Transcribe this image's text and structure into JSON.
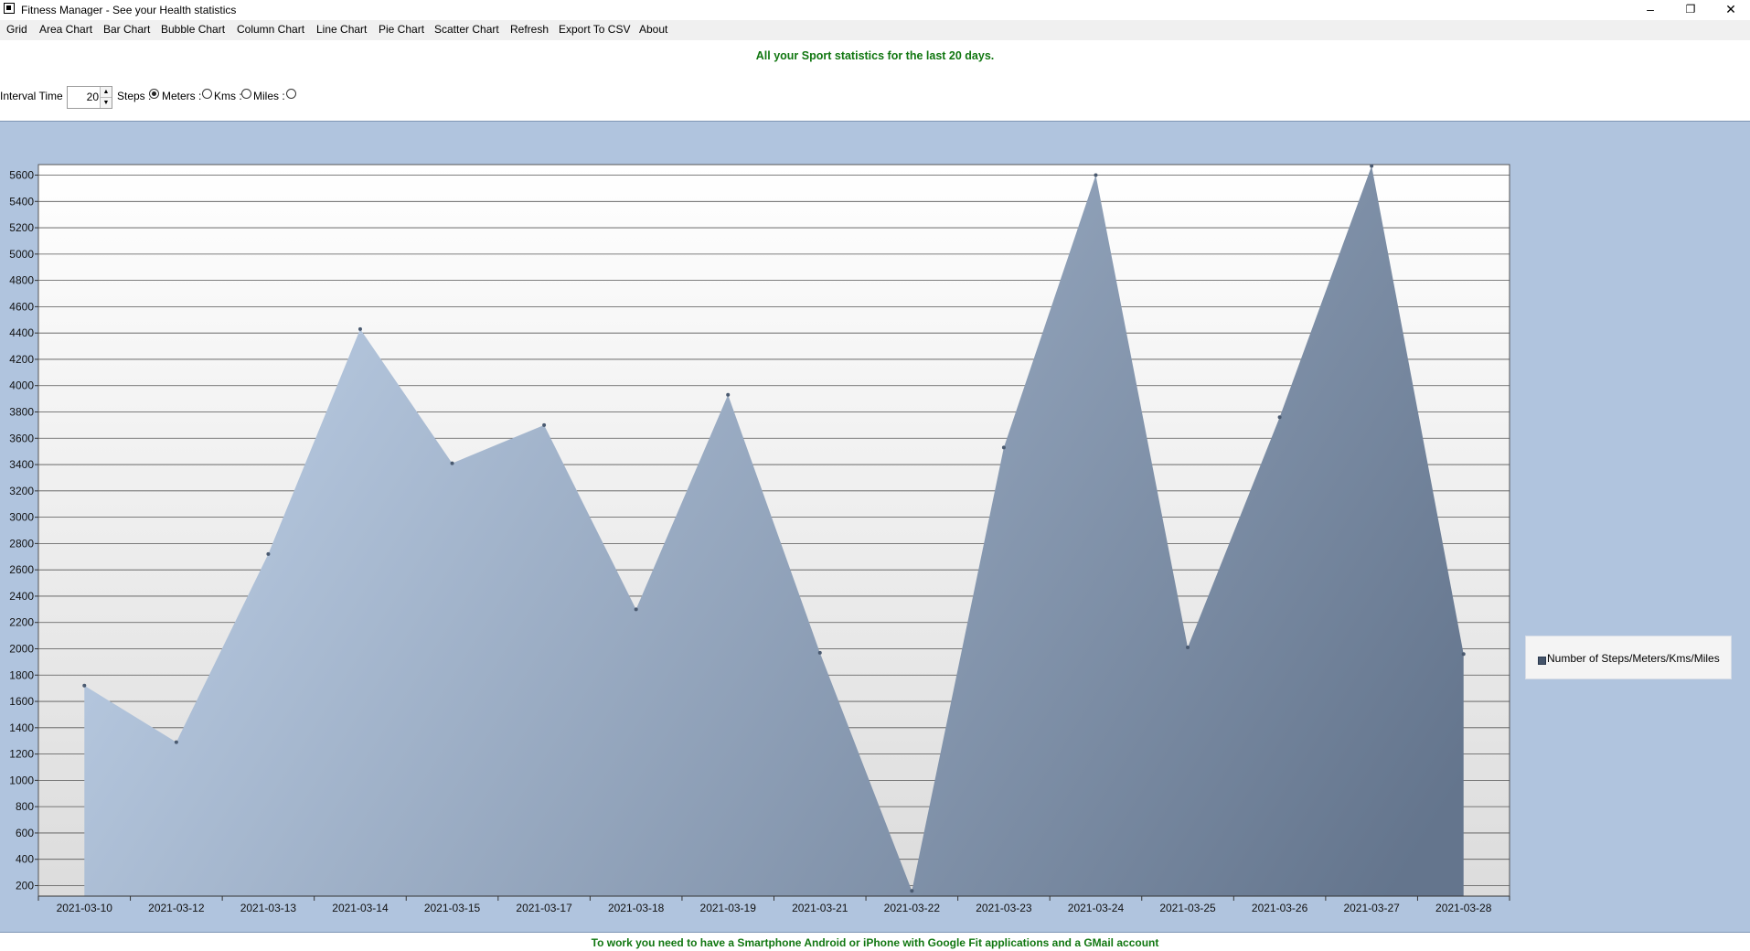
{
  "window": {
    "title": "Fitness Manager - See your Health statistics",
    "minimize": "–",
    "restore": "❐",
    "close": "✕"
  },
  "menu": {
    "items": [
      "Grid",
      "Area Chart",
      "Bar Chart",
      "Bubble Chart",
      "Column Chart",
      "Line Chart",
      "Pie Chart",
      "Scatter Chart",
      "Refresh",
      "Export To CSV",
      "About"
    ]
  },
  "header_message": "All your Sport statistics for the last 20 days.",
  "controls": {
    "interval_label": "Interval Time :",
    "interval_value": "20",
    "options": [
      {
        "label": "Steps :",
        "checked": true
      },
      {
        "label": "Meters :",
        "checked": false
      },
      {
        "label": "Kms :",
        "checked": false
      },
      {
        "label": "Miles :",
        "checked": false
      }
    ]
  },
  "chart_data": {
    "type": "area",
    "x": [
      "2021-03-10",
      "2021-03-12",
      "2021-03-13",
      "2021-03-14",
      "2021-03-15",
      "2021-03-17",
      "2021-03-18",
      "2021-03-19",
      "2021-03-21",
      "2021-03-22",
      "2021-03-23",
      "2021-03-24",
      "2021-03-25",
      "2021-03-26",
      "2021-03-27",
      "2021-03-28"
    ],
    "series": [
      {
        "name": "Number of Steps/Meters/Kms/Miles",
        "values": [
          1720,
          1290,
          2720,
          4430,
          3410,
          3700,
          2300,
          3930,
          1970,
          160,
          3530,
          5600,
          2010,
          3760,
          5670,
          1960
        ]
      }
    ],
    "ylim": [
      120,
      5680
    ],
    "yticks": [
      200,
      400,
      600,
      800,
      1000,
      1200,
      1400,
      1600,
      1800,
      2000,
      2200,
      2400,
      2600,
      2800,
      3000,
      3200,
      3400,
      3600,
      3800,
      4000,
      4200,
      4400,
      4600,
      4800,
      5000,
      5200,
      5400,
      5600
    ],
    "grid": true,
    "legend_position": "right",
    "colors": {
      "fill_light": "#b3c5dc",
      "fill_dark": "#64758d",
      "panel": "#b0c4de"
    }
  },
  "footer_message": "To work you need to have a Smartphone Android or iPhone with Google Fit applications and a GMail account"
}
